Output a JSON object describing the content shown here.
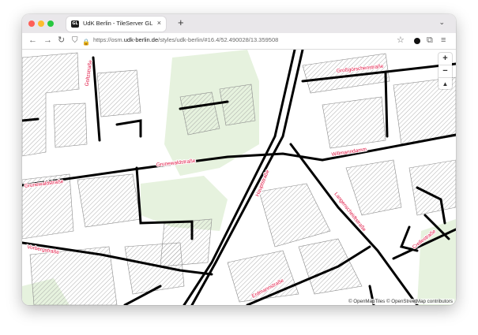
{
  "browser": {
    "tab_title": "UdK Berlin - TileServer GL",
    "tab_favicon": "GL",
    "tab_close": "×",
    "new_tab": "+",
    "tab_list": "⌄",
    "url_prefix": "https://osm.",
    "url_domain": "udk-berlin.de",
    "url_path": "/styles/udk-berlin/#16.4/52.490028/13.359508",
    "icons": {
      "back": "←",
      "forward": "→",
      "reload": "↻",
      "shield": "⛉",
      "lock": "🔒",
      "bookmark": "☆",
      "extensions": "⧉",
      "menu": "≡"
    }
  },
  "map": {
    "zoom_in": "+",
    "zoom_out": "−",
    "compass": "▲",
    "attribution": "© OpenMapTiles © OpenStreetMap contributors",
    "street_labels": {
      "grossgoerschen": "Großgörschenstraße",
      "goltz": "Goltzstraße",
      "grunewald_a": "Grunewaldstraße",
      "grunewald_b": "Grunewaldstraße",
      "willmann": "Willmanndamm",
      "haupt": "Hauptstraße",
      "langenscheidt": "Langenscheidtstraße",
      "crelle": "Crellestraße",
      "vorberg": "Vorbergstraße",
      "erdmann": "Erdmannstraße"
    },
    "colors": {
      "road": "#000000",
      "label": "#e0103f",
      "park": "#e6f2de",
      "building_hatch": "#9a9a9a"
    }
  }
}
